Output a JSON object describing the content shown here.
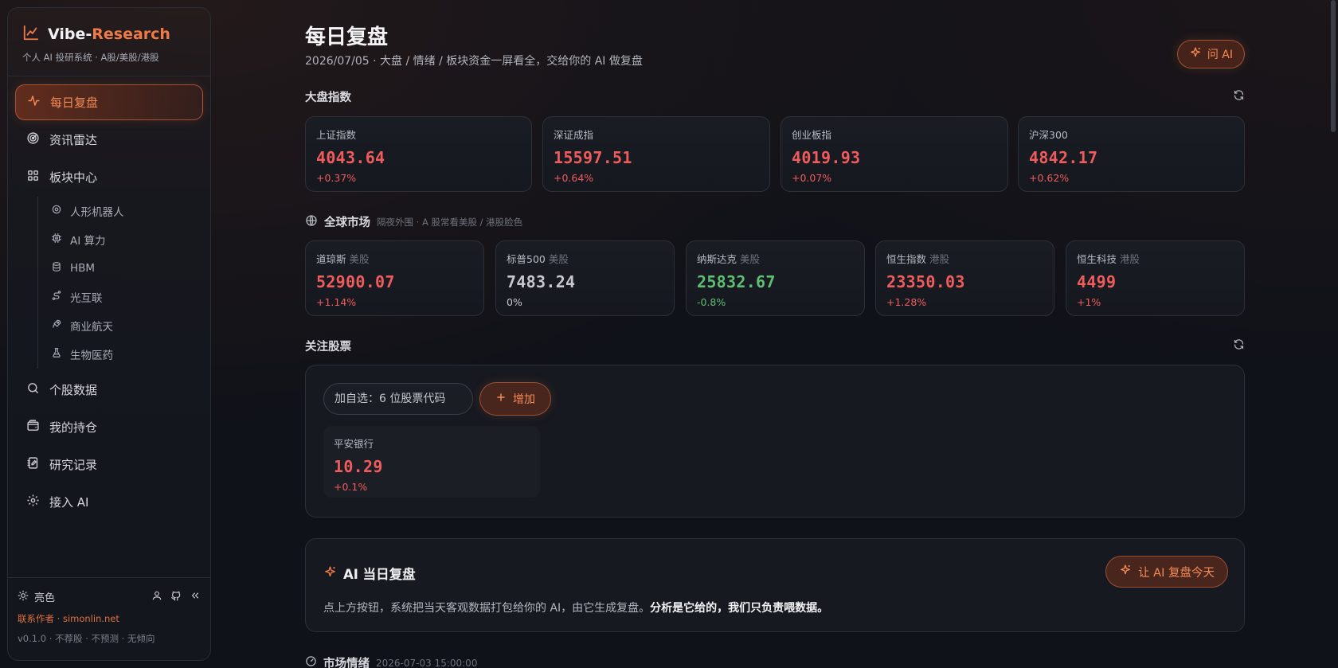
{
  "brand": {
    "title_main": "Vibe-",
    "title_accent": "Research",
    "subtitle": "个人 AI 投研系统 · A股/美股/港股",
    "icon": "line-chart-icon"
  },
  "nav": {
    "items": [
      {
        "label": "每日复盘",
        "icon": "pulse-icon",
        "active": true
      },
      {
        "label": "资讯雷达",
        "icon": "radar-icon"
      },
      {
        "label": "板块中心",
        "icon": "grid-icon"
      },
      {
        "label": "个股数据",
        "icon": "search-icon"
      },
      {
        "label": "我的持仓",
        "icon": "wallet-icon"
      },
      {
        "label": "研究记录",
        "icon": "notebook-icon"
      },
      {
        "label": "接入 AI",
        "icon": "gear-icon"
      }
    ],
    "sectors": [
      {
        "label": "人形机器人",
        "icon": "cog-icon"
      },
      {
        "label": "AI 算力",
        "icon": "chip-icon"
      },
      {
        "label": "HBM",
        "icon": "database-icon"
      },
      {
        "label": "光互联",
        "icon": "route-icon"
      },
      {
        "label": "商业航天",
        "icon": "rocket-icon"
      },
      {
        "label": "生物医药",
        "icon": "flask-icon"
      }
    ]
  },
  "footer": {
    "theme_label": "亮色",
    "contact": "联系作者 · simonlin.net",
    "version": "v0.1.0 · 不荐股 · 不预测 · 无倾向"
  },
  "header": {
    "title": "每日复盘",
    "subtitle": "2026/07/05 · 大盘 / 情绪 / 板块资金一屏看全，交给你的 AI 做复盘",
    "ask_ai_label": "问 AI"
  },
  "indices": {
    "title": "大盘指数",
    "items": [
      {
        "name": "上证指数",
        "value": "4043.64",
        "change": "+0.37%",
        "dir": "up"
      },
      {
        "name": "深证成指",
        "value": "15597.51",
        "change": "+0.64%",
        "dir": "up"
      },
      {
        "name": "创业板指",
        "value": "4019.93",
        "change": "+0.07%",
        "dir": "up"
      },
      {
        "name": "沪深300",
        "value": "4842.17",
        "change": "+0.62%",
        "dir": "up"
      }
    ]
  },
  "global": {
    "title": "全球市场",
    "note": "隔夜外围 · A 股常看美股 / 港股脸色",
    "items": [
      {
        "name": "道琼斯",
        "market": "美股",
        "value": "52900.07",
        "change": "+1.14%",
        "dir": "up"
      },
      {
        "name": "标普500",
        "market": "美股",
        "value": "7483.24",
        "change": "0%",
        "dir": "flat"
      },
      {
        "name": "纳斯达克",
        "market": "美股",
        "value": "25832.67",
        "change": "-0.8%",
        "dir": "down"
      },
      {
        "name": "恒生指数",
        "market": "港股",
        "value": "23350.03",
        "change": "+1.28%",
        "dir": "up"
      },
      {
        "name": "恒生科技",
        "market": "港股",
        "value": "4499",
        "change": "+1%",
        "dir": "up"
      }
    ]
  },
  "watchlist": {
    "title": "关注股票",
    "input_placeholder": "加自选：6 位股票代码",
    "add_label": "增加",
    "stocks": [
      {
        "name": "平安银行",
        "value": "10.29",
        "change": "+0.1%",
        "dir": "up"
      }
    ]
  },
  "ai_review": {
    "title": "AI 当日复盘",
    "button_label": "让 AI 复盘今天",
    "desc_plain": "点上方按钮，系统把当天客观数据打包给你的 AI，由它生成复盘。",
    "desc_bold": "分析是它给的，我们只负责喂数据。"
  },
  "sentiment": {
    "title": "市场情绪",
    "timestamp": "2026-07-03 15:00:00"
  },
  "colors": {
    "accent": "#f07a45",
    "up": "#ef5c5c",
    "down": "#5fbf72",
    "background": "#101219"
  }
}
